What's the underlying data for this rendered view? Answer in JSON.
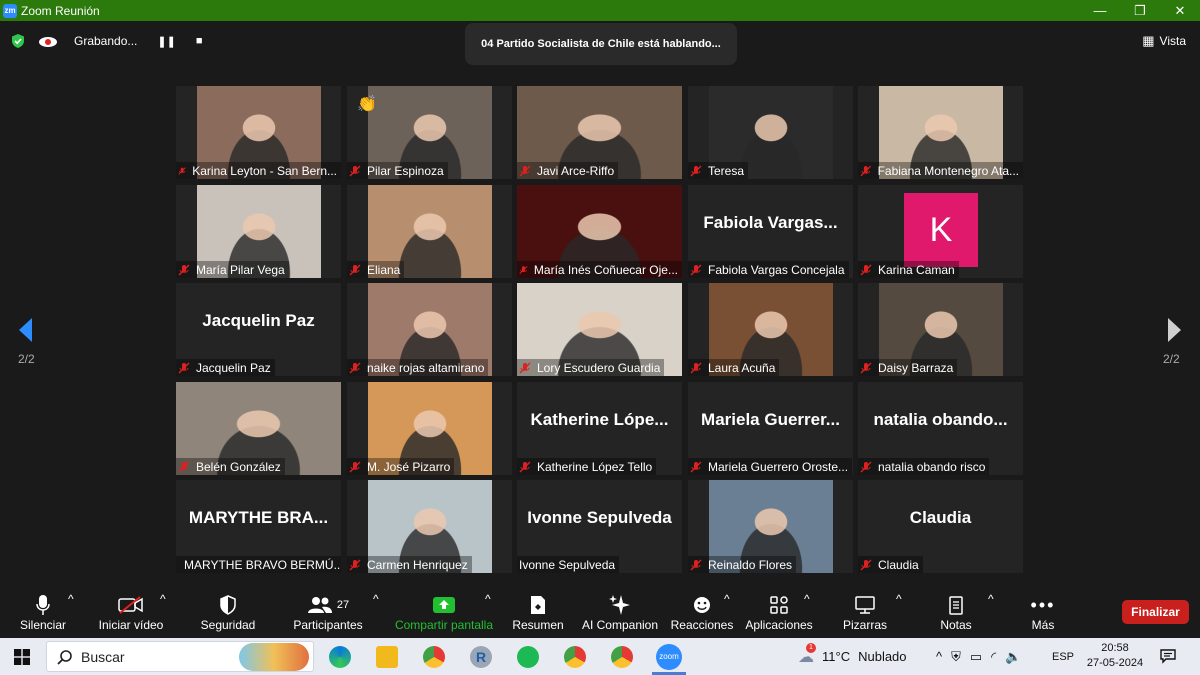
{
  "window": {
    "title": "Zoom Reunión",
    "app_icon": "zm",
    "controls": [
      "—",
      "❐",
      "✕"
    ]
  },
  "meeting_bar": {
    "recording_label": "Grabando...",
    "active_speaker": "04 Partido Socialista de Chile está hablando...",
    "view_label": "Vista"
  },
  "pagination": {
    "left": "2/2",
    "right": "2/2"
  },
  "participants": [
    {
      "label": "Karina Leyton - San Bern...",
      "video": true,
      "bg": "#8a6b5c"
    },
    {
      "label": "Pilar Espinoza",
      "video": true,
      "bg": "#6d6259",
      "reaction": "👏"
    },
    {
      "label": "Javi Arce-Riffo",
      "video": true,
      "bg": "#6e5a4a"
    },
    {
      "label": "Teresa",
      "video": true,
      "bg": "#2b2b2b"
    },
    {
      "label": "Fabiana Montenegro Ata...",
      "video": true,
      "bg": "#c9b9a4"
    },
    {
      "label": "María Pilar Vega",
      "video": true,
      "bg": "#c9c2ba"
    },
    {
      "label": "Eliana",
      "video": true,
      "bg": "#b88f6e"
    },
    {
      "label": "María Inés Coñuecar Oje...",
      "video": true,
      "bg": "#4a1010"
    },
    {
      "label": "Fabiola Vargas Concejala",
      "name": "Fabiola  Vargas...",
      "video": false
    },
    {
      "label": "Karina Caman",
      "avatar": "K",
      "avatar_color": "#e0196c",
      "video": false
    },
    {
      "label": "Jacquelin Paz",
      "name": "Jacquelin Paz",
      "video": false
    },
    {
      "label": "naike rojas altamirano",
      "video": true,
      "bg": "#9e7a6a"
    },
    {
      "label": "Lory Escudero   Guardia",
      "video": true,
      "bg": "#d8d2c8"
    },
    {
      "label": "Laura Acuña",
      "video": true,
      "bg": "#7a5034"
    },
    {
      "label": "Daisy Barraza",
      "video": true,
      "bg": "#554a40"
    },
    {
      "label": "Belén González",
      "video": true,
      "bg": "#8f857a"
    },
    {
      "label": "M. José Pizarro",
      "video": true,
      "bg": "#d59858"
    },
    {
      "label": "Katherine López Tello",
      "name": "Katherine  Lópe...",
      "video": false
    },
    {
      "label": "Mariela Guerrero Oroste...",
      "name": "Mariela  Guerrer...",
      "video": false
    },
    {
      "label": "natalia obando risco",
      "name": "natalia  obando...",
      "video": false
    },
    {
      "label": "MARYTHE BRAVO BERMÚ...",
      "name": "MARYTHE  BRA...",
      "video": false
    },
    {
      "label": "Carmen Henriquez",
      "video": true,
      "bg": "#b9c4c9"
    },
    {
      "label": "Ivonne Sepulveda",
      "name": "Ivonne Sepulveda",
      "video": false,
      "unmuted": true
    },
    {
      "label": "Reinaldo Flores",
      "video": true,
      "bg": "#6a7f93"
    },
    {
      "label": "Claudia",
      "name": "Claudia",
      "video": false
    }
  ],
  "toolbar": {
    "mute": "Silenciar",
    "video": "Iniciar vídeo",
    "security": "Seguridad",
    "participants": "Participantes",
    "participants_count": "27",
    "share": "Compartir pantalla",
    "summary": "Resumen",
    "companion": "AI Companion",
    "reactions": "Reacciones",
    "apps": "Aplicaciones",
    "whiteboards": "Pizarras",
    "notes": "Notas",
    "more": "Más",
    "end": "Finalizar"
  },
  "taskbar": {
    "search_placeholder": "Buscar",
    "weather_temp": "11°C",
    "weather_desc": "Nublado",
    "weather_badge": "1",
    "language": "ESP",
    "time": "20:58",
    "date": "27-05-2024"
  },
  "colors": {
    "titlebar": "#2b7a0b",
    "share_green": "#20c030",
    "end_red": "#c9201e",
    "zoom_blue": "#2d8cff"
  }
}
